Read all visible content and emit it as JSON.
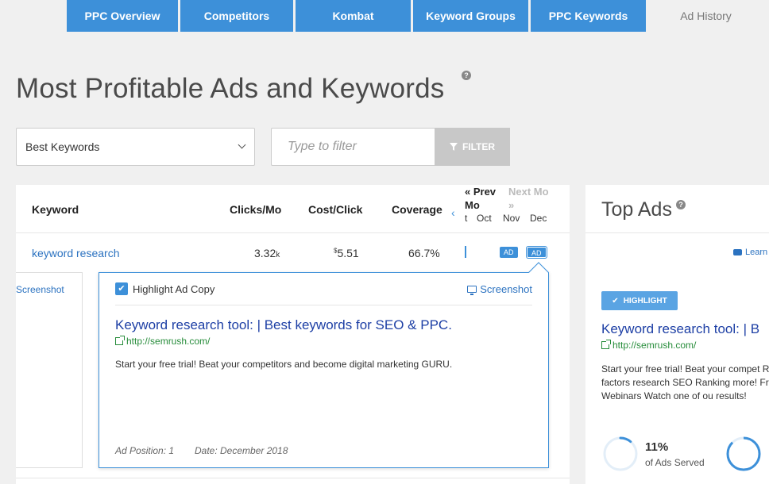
{
  "tabs": [
    {
      "label": "PPC Overview",
      "active": false
    },
    {
      "label": "Competitors",
      "active": false
    },
    {
      "label": "Kombat",
      "active": false
    },
    {
      "label": "Keyword Groups",
      "active": false
    },
    {
      "label": "PPC Keywords",
      "active": false
    },
    {
      "label": "Ad History",
      "active": true
    }
  ],
  "page": {
    "title": "Most Profitable Ads and Keywords",
    "help": "?"
  },
  "controls": {
    "select_value": "Best Keywords",
    "filter_placeholder": "Type to filter",
    "filter_button": "FILTER"
  },
  "table": {
    "headers": {
      "keyword": "Keyword",
      "clicks": "Clicks/Mo",
      "cost": "Cost/Click",
      "coverage": "Coverage"
    },
    "nav": {
      "prev": "« Prev Mo",
      "next": "Next Mo »",
      "prev_chevron": "‹"
    },
    "months": {
      "cut": "t",
      "oct": "Oct",
      "nov": "Nov",
      "dec": "Dec"
    },
    "row": {
      "keyword": "keyword research",
      "clicks_value": "3.32",
      "clicks_unit": "k",
      "cost_currency": "$",
      "cost_value": "5.51",
      "coverage": "66.7%",
      "badge_nov": "AD",
      "badge_dec": "AD"
    },
    "left_screenshot": "Screenshot"
  },
  "popup": {
    "highlight_label": "Highlight Ad Copy",
    "screenshot_label": "Screenshot",
    "ad_title": "Keyword research tool: | Best keywords for SEO & PPC.",
    "ad_url": "http://semrush.com/",
    "ad_desc": "Start your free trial! Beat your competitors and become digital marketing GURU.",
    "ad_position": "Ad Position: 1",
    "date": "Date: December 2018"
  },
  "top_ads": {
    "title": "Top Ads",
    "help": "?",
    "learn": "Learn",
    "highlight_button": "HIGHLIGHT",
    "ad_title": "Keyword research tool: | B",
    "ad_url": "http://semrush.com/",
    "ad_desc": "Start your free trial! Beat your compet Ranking factors research SEO Ranking more! Free Webinars Watch one of ou results!",
    "pct": "11%",
    "pct_label": "of Ads Served",
    "pct_value": 0.11
  },
  "colors": {
    "accent": "#3d90d9",
    "link": "#2b72c0",
    "ad_title": "#1d3fa5",
    "url_green": "#268c3a"
  }
}
